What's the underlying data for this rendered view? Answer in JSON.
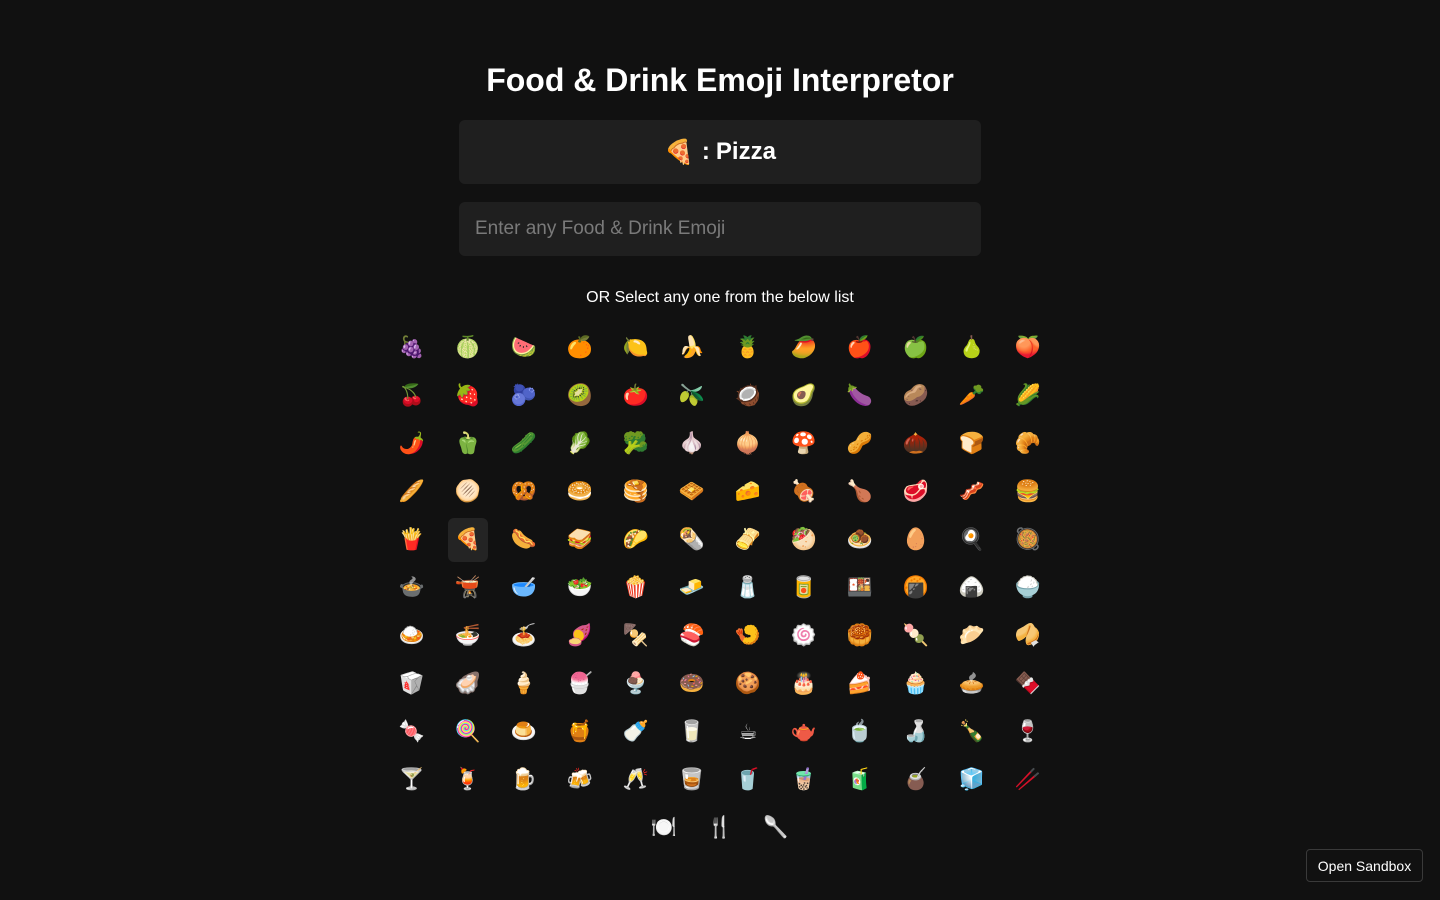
{
  "header": {
    "title": "Food & Drink Emoji Interpretor"
  },
  "result": {
    "emoji": "🍕",
    "separator": ":",
    "meaning": "Pizza"
  },
  "input": {
    "placeholder": "Enter any Food & Drink Emoji",
    "value": ""
  },
  "subtitle": "OR Select any one from the below list",
  "selected_emoji": "🍕",
  "emojis": [
    "🍇",
    "🍈",
    "🍉",
    "🍊",
    "🍋",
    "🍌",
    "🍍",
    "🥭",
    "🍎",
    "🍏",
    "🍐",
    "🍑",
    "🍒",
    "🍓",
    "🫐",
    "🥝",
    "🍅",
    "🫒",
    "🥥",
    "🥑",
    "🍆",
    "🥔",
    "🥕",
    "🌽",
    "🌶️",
    "🫑",
    "🥒",
    "🥬",
    "🥦",
    "🧄",
    "🧅",
    "🍄",
    "🥜",
    "🌰",
    "🍞",
    "🥐",
    "🥖",
    "🫓",
    "🥨",
    "🥯",
    "🥞",
    "🧇",
    "🧀",
    "🍖",
    "🍗",
    "🥩",
    "🥓",
    "🍔",
    "🍟",
    "🍕",
    "🌭",
    "🥪",
    "🌮",
    "🌯",
    "🫔",
    "🥙",
    "🧆",
    "🥚",
    "🍳",
    "🥘",
    "🍲",
    "🫕",
    "🥣",
    "🥗",
    "🍿",
    "🧈",
    "🧂",
    "🥫",
    "🍱",
    "🍘",
    "🍙",
    "🍚",
    "🍛",
    "🍜",
    "🍝",
    "🍠",
    "🍢",
    "🍣",
    "🍤",
    "🍥",
    "🥮",
    "🍡",
    "🥟",
    "🥠",
    "🥡",
    "🦪",
    "🍦",
    "🍧",
    "🍨",
    "🍩",
    "🍪",
    "🎂",
    "🍰",
    "🧁",
    "🥧",
    "🍫",
    "🍬",
    "🍭",
    "🍮",
    "🍯",
    "🍼",
    "🥛",
    "☕",
    "🫖",
    "🍵",
    "🍶",
    "🍾",
    "🍷",
    "🍸",
    "🍹",
    "🍺",
    "🍻",
    "🥂",
    "🥃",
    "🥤",
    "🧋",
    "🧃",
    "🧉",
    "🧊",
    "🥢",
    "🍽️",
    "🍴",
    "🥄"
  ],
  "footer": {
    "sandbox_label": "Open Sandbox"
  }
}
